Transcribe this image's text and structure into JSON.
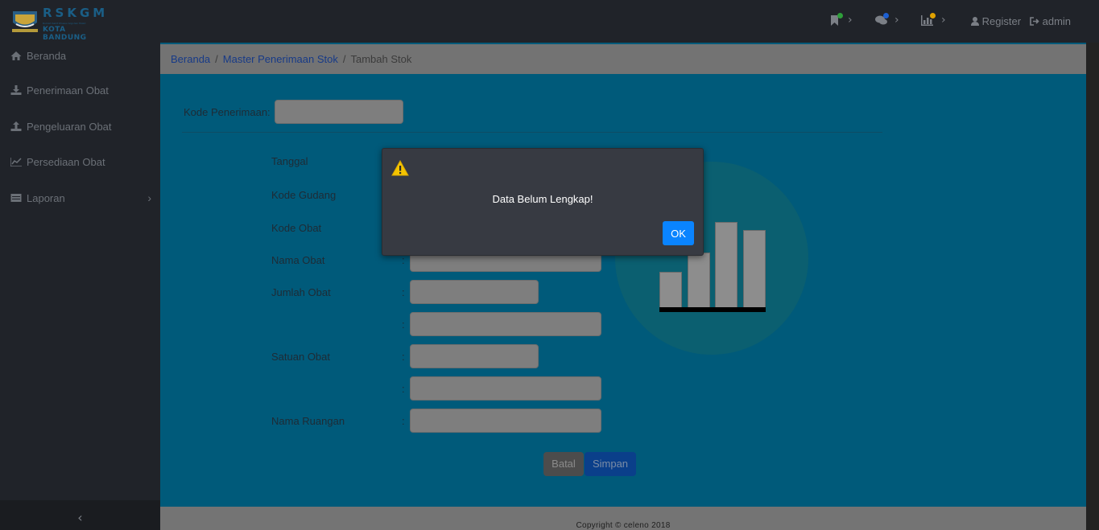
{
  "brand": {
    "title": "RSKGM",
    "tiny_text": "Rumah Sakit Khusus Gigi dan Mulut",
    "subtitle": "KOTA BANDUNG"
  },
  "topnav": {
    "notif_bookmark_icon": "bookmark-icon",
    "notif_comments_icon": "comments-icon",
    "notif_chart_icon": "bar-chart-icon",
    "dot_colors": [
      "#2e9e3a",
      "#1c5fd1",
      "#e0a100"
    ],
    "register_label": "Register",
    "admin_label": "admin"
  },
  "sidebar": {
    "items": [
      {
        "label": "Beranda",
        "icon": "home-icon"
      },
      {
        "label": "Penerimaan Obat",
        "icon": "download-icon"
      },
      {
        "label": "Pengeluaran Obat",
        "icon": "upload-icon"
      },
      {
        "label": "Persediaan Obat",
        "icon": "line-chart-icon"
      },
      {
        "label": "Laporan",
        "icon": "table-icon"
      }
    ],
    "collapse_glyph": "‹"
  },
  "breadcrumb": {
    "home": "Beranda",
    "parent": "Master Penerimaan Stok",
    "current": "Tambah Stok",
    "separator": "/"
  },
  "form": {
    "kode_penerimaan_label": "Kode Penerimaan",
    "colon": ":",
    "tanggal_label": "Tanggal",
    "kode_gudang_label": "Kode Gudang",
    "kode_obat_label": "Kode Obat",
    "nama_obat_label": "Nama Obat",
    "jumlah_obat_label": "Jumlah Obat",
    "satuan_obat_label": "Satuan Obat",
    "nama_ruangan_label": "Nama Ruangan",
    "batal_label": "Batal",
    "simpan_label": "Simpan"
  },
  "footer": {
    "copyright": "Copyright © celeno 2018"
  },
  "dialog": {
    "icon": "warning-icon",
    "message": "Data Belum Lengkap!",
    "ok_label": "OK",
    "accent": "#0a84ff"
  }
}
